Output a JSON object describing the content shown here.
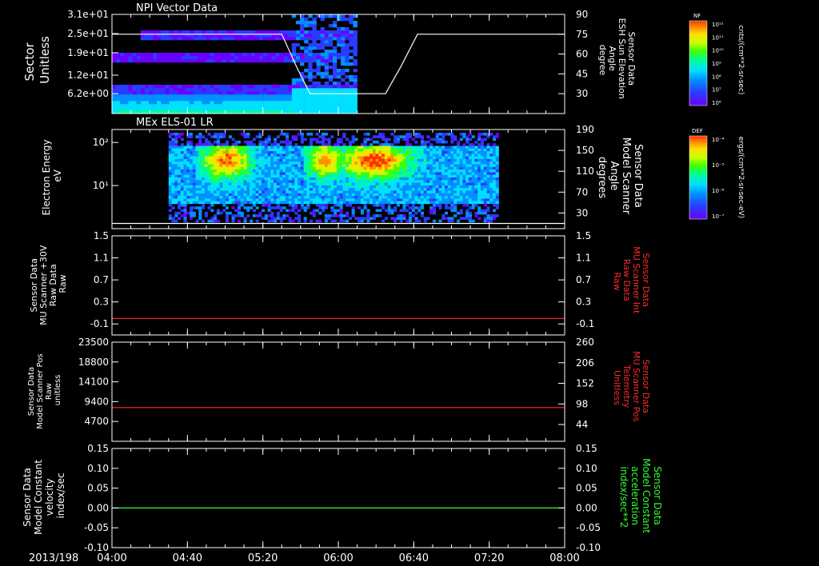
{
  "colors": {
    "background": "#000000",
    "axis": "#ffffff",
    "trace_red": "#ff2a2a",
    "trace_green": "#33ff33"
  },
  "colormap": [
    "#6a00ff",
    "#2a3cff",
    "#0090ff",
    "#00e0ff",
    "#00ff90",
    "#40ff00",
    "#c8ff00",
    "#ffe000",
    "#ff9000",
    "#ff3000"
  ],
  "time_axis": {
    "date_label": "2013/198",
    "ticks": [
      "04:00",
      "04:40",
      "05:20",
      "06:00",
      "06:40",
      "07:20",
      "08:00"
    ],
    "range": [
      "04:00",
      "08:00"
    ]
  },
  "colorbars": [
    {
      "title": "NF",
      "unit_label": "cnts/(cm**2-sr-sec)",
      "ticks": [
        "10¹²",
        "10¹¹",
        "10¹⁰",
        "10⁹",
        "10⁸",
        "10⁷",
        "10⁶"
      ]
    },
    {
      "title": "DEF",
      "unit_label": "ergs/(cm**2-sr-sec-eV)",
      "ticks": [
        "10⁻⁴",
        "10⁻⁵",
        "10⁻⁶",
        "10⁻⁷"
      ]
    }
  ],
  "chart_data": [
    {
      "type": "heatmap",
      "title": "NPI Vector Data",
      "ylabel_lines": [
        "Sector",
        "Unitless"
      ],
      "y_ticks": [
        "3.1e+01",
        "2.5e+01",
        "1.9e+01",
        "1.2e+01",
        "6.2e+00"
      ],
      "ylim": [
        0,
        31
      ],
      "y2label_lines": [
        "Sensor Data",
        "ESH Sun Elevation",
        "Angle",
        "degree"
      ],
      "y2_ticks": [
        "90",
        "75",
        "60",
        "45",
        "30"
      ],
      "y2lim": [
        15,
        90
      ],
      "data_extent_x": [
        "04:00",
        "06:10"
      ],
      "line_series": {
        "axis": "right",
        "x": [
          "04:00",
          "05:30",
          "05:38",
          "05:45",
          "06:25",
          "06:33",
          "06:42",
          "08:00"
        ],
        "y": [
          75,
          75,
          50,
          30,
          30,
          50,
          75,
          75
        ]
      }
    },
    {
      "type": "heatmap",
      "title": "MEx ELS-01 LR",
      "ylabel_lines": [
        "Electron Energy",
        "eV"
      ],
      "y_ticks": [
        "10²",
        "10¹"
      ],
      "y_log": true,
      "ylim": [
        1,
        200
      ],
      "y2label_lines": [
        "Sensor Data",
        "Model Scanner",
        "Angle",
        "degrees"
      ],
      "y2_ticks": [
        "190",
        "150",
        "110",
        "70",
        "30"
      ],
      "y2lim": [
        0,
        190
      ],
      "data_extent_x": [
        "04:30",
        "07:25"
      ],
      "line_series": {
        "axis": "right",
        "x": [
          "04:00",
          "08:00"
        ],
        "y": [
          10,
          10
        ]
      }
    },
    {
      "type": "line",
      "ylabel_lines": [
        "Sensor Data",
        "MU Scanner +30V",
        "Raw Data",
        "Raw"
      ],
      "y_ticks": [
        "1.5",
        "1.1",
        "0.7",
        "0.3",
        "-0.1"
      ],
      "ylim": [
        -0.3,
        1.5
      ],
      "y2label_lines": [
        "Sensor Data",
        "MU Scanner Int",
        "Raw Data",
        "Raw"
      ],
      "y2_ticks": [
        "1.5",
        "1.1",
        "0.7",
        "0.3",
        "-0.1"
      ],
      "y2lim": [
        -0.3,
        1.5
      ],
      "series_color": "#ff2a2a",
      "x": [
        "04:00",
        "08:00"
      ],
      "y": [
        0.0,
        0.0
      ]
    },
    {
      "type": "line",
      "ylabel_lines": [
        "Sensor Data",
        "Model Scanner Pos",
        "Raw",
        "unitless"
      ],
      "y_ticks": [
        "23500",
        "18800",
        "14100",
        "9400",
        "4700"
      ],
      "ylim": [
        0,
        23500
      ],
      "y2label_lines": [
        "Sensor Data",
        "MU Scanner Pos",
        "Telemetry",
        "Unitless"
      ],
      "y2_ticks": [
        "260",
        "206",
        "152",
        "98",
        "44"
      ],
      "y2lim": [
        0,
        260
      ],
      "series_color": "#ff2a2a",
      "x": [
        "04:00",
        "08:00"
      ],
      "y": [
        8000,
        8000
      ]
    },
    {
      "type": "line",
      "ylabel_lines": [
        "Sensor Data",
        "Model Constant",
        "velocity",
        "index/sec"
      ],
      "y_ticks": [
        "0.15",
        "0.10",
        "0.05",
        "0.00",
        "-0.05",
        "-0.10"
      ],
      "ylim": [
        -0.1,
        0.15
      ],
      "y2label_lines": [
        "Sensor Data",
        "Model Constant",
        "acceleration",
        "index/sec**2"
      ],
      "y2_ticks": [
        "0.15",
        "0.10",
        "0.05",
        "0.00",
        "-0.05",
        "-0.10"
      ],
      "y2lim": [
        -0.1,
        0.15
      ],
      "series_color": "#33ff33",
      "x": [
        "04:00",
        "08:00"
      ],
      "y": [
        0.0,
        0.0
      ]
    }
  ]
}
